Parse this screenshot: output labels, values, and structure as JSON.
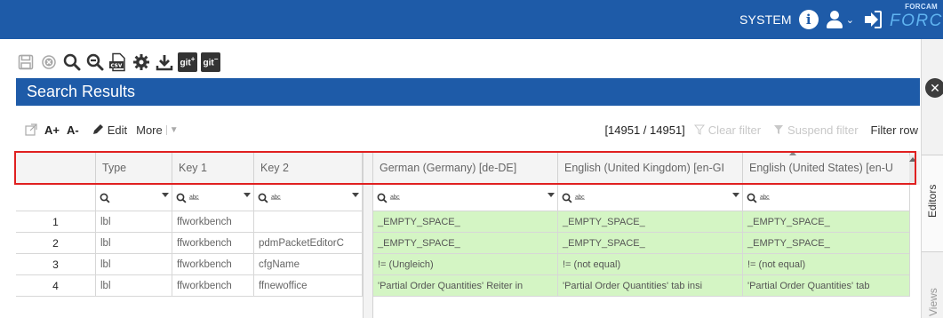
{
  "topbar": {
    "user_name": "SYSTEM",
    "logo_top": "FORCAM",
    "logo_main": "FORCE",
    "icons": [
      "info-icon",
      "user-icon",
      "chevron-down-icon",
      "sign-out-icon"
    ]
  },
  "toolbar": {
    "icons": [
      "save-icon",
      "cancel-icon",
      "search-icon",
      "search-minus-icon",
      "csv-export-icon",
      "settings-icon",
      "download-icon",
      "git-add-icon",
      "git-icon"
    ],
    "csv_label": "csv",
    "git_label": "git"
  },
  "panel": {
    "title": "Search Results"
  },
  "actions": {
    "font_increase": "A+",
    "font_decrease": "A-",
    "edit_label": "Edit",
    "more_label": "More",
    "count": "[14951 / 14951]",
    "clear_filter": "Clear filter",
    "suspend_filter": "Suspend filter",
    "filter_row": "Filter row"
  },
  "sidebar": {
    "editors_label": "Editors",
    "views_label": "Views"
  },
  "grid": {
    "columns": [
      "",
      "Type",
      "Key 1",
      "Key 2",
      "German (Germany) [de-DE]",
      "English (United Kingdom) [en-GI",
      "English (United States) [en-U"
    ],
    "rows": [
      {
        "num": "1",
        "type": "lbl",
        "key1": "ffworkbench",
        "key2": "",
        "de": "_EMPTY_SPACE_",
        "gb": "_EMPTY_SPACE_",
        "us": "_EMPTY_SPACE_"
      },
      {
        "num": "2",
        "type": "lbl",
        "key1": "ffworkbench",
        "key2": "pdmPacketEditorC",
        "de": "_EMPTY_SPACE_",
        "gb": "_EMPTY_SPACE_",
        "us": "_EMPTY_SPACE_"
      },
      {
        "num": "3",
        "type": "lbl",
        "key1": "ffworkbench",
        "key2": "cfgName",
        "de": "!= (Ungleich)",
        "gb": "!= (not equal)",
        "us": "!= (not equal)"
      },
      {
        "num": "4",
        "type": "lbl",
        "key1": "ffworkbench",
        "key2": "ffnewoffice",
        "de": "'Partial Order Quantities' Reiter in",
        "gb": "'Partial Order Quantities' tab insi",
        "us": "'Partial Order Quantities' tab"
      }
    ],
    "highlight_color": "#d4f5c4"
  },
  "colors": {
    "brand_blue": "#1e5ba8",
    "highlight_border": "#e02020"
  }
}
